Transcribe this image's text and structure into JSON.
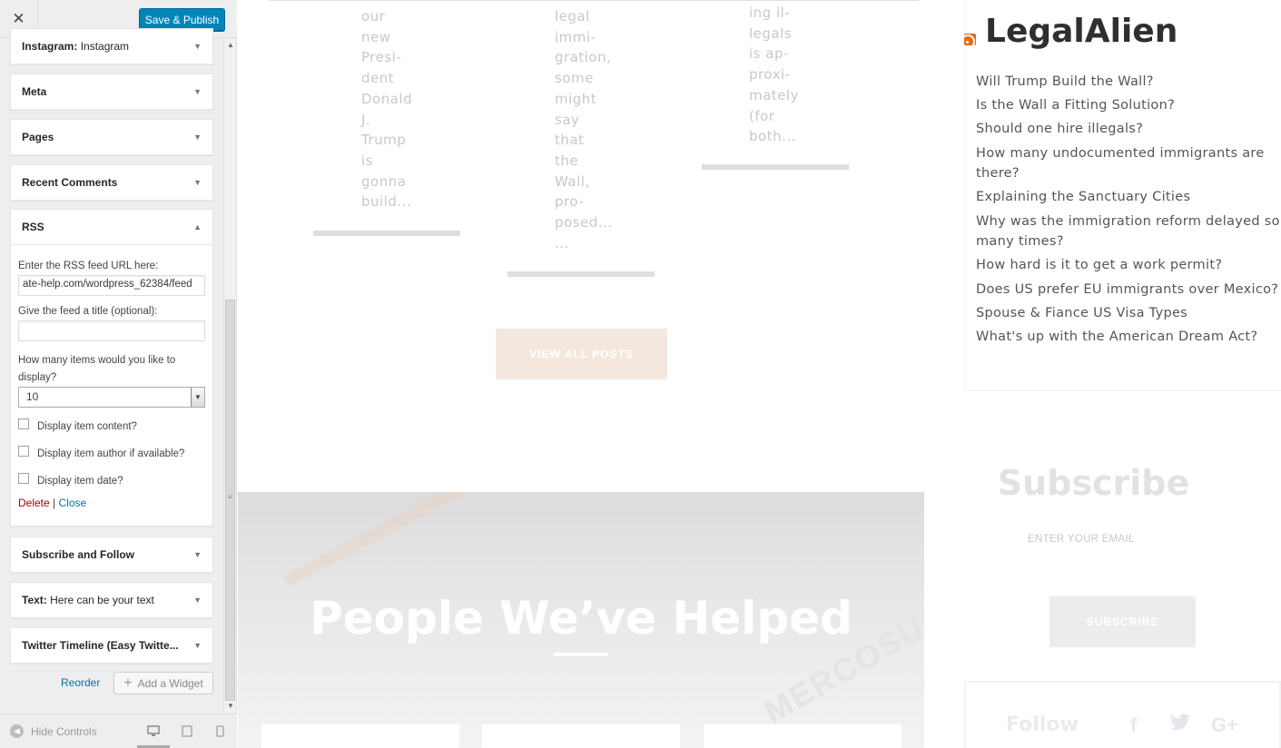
{
  "header": {
    "close_glyph": "✕",
    "publish_label": "Save & Publish"
  },
  "widgets": {
    "instagram": {
      "bold": "Instagram:",
      "rest": " Instagram"
    },
    "meta": {
      "bold": "Meta"
    },
    "pages": {
      "bold": "Pages"
    },
    "recent_comments": {
      "bold": "Recent Comments"
    },
    "rss": {
      "bold": "RSS"
    },
    "subscribe_follow": {
      "bold": "Subscribe and Follow"
    },
    "text": {
      "bold": "Text:",
      "rest": " Here can be your text"
    },
    "twitter": {
      "bold": "Twitter Timeline (Easy Twitte..."
    }
  },
  "rss_form": {
    "url_label": "Enter the RSS feed URL here:",
    "url_value": "ate-help.com/wordpress_62384/feed",
    "title_label": "Give the feed a title (optional):",
    "title_value": "",
    "items_label": "How many items would you like to display?",
    "items_value": "10",
    "opt_content": "Display item content?",
    "opt_author": "Display item author if available?",
    "opt_date": "Display item date?",
    "delete_label": "Delete",
    "separator": " | ",
    "close_label": "Close"
  },
  "footer": {
    "reorder_label": "Reorder",
    "add_widget_label": "Add a Widget",
    "hide_controls_label": "Hide Controls"
  },
  "preview": {
    "columns": [
      {
        "lines": [
          "our",
          "new",
          "Presi-",
          "dent",
          "Donald",
          "J.",
          "Trump",
          "is",
          "gonna",
          "build..."
        ]
      },
      {
        "lines": [
          "legal",
          "immi-",
          "gration,",
          "some",
          "might",
          "say",
          "that",
          "the",
          "Wall,",
          "pro-",
          "posed...",
          "..."
        ]
      },
      {
        "lines": [
          "ing il-",
          "legals",
          "is ap-",
          "proxi-",
          "mately",
          "(for",
          "both..."
        ]
      }
    ],
    "view_all_label": "VIEW ALL POSTS",
    "hero_title": "People We’ve Helped",
    "hero_watermark": "MERCOSUL FEDE",
    "rss_widget_title": "LegalAlien",
    "rss_items": [
      "Will Trump Build the Wall?",
      "Is the Wall a Fitting Solution?",
      "Should one hire illegals?",
      "How many undocumented immigrants are there?",
      "Explaining the Sanctuary Cities",
      "Why was the immigration reform delayed so many times?",
      "How hard is it to get a work permit?",
      "Does US prefer EU immigrants over Mexico?",
      "Spouse & Fiance US Visa Types",
      "What's up with the American Dream Act?"
    ],
    "subscribe_title": "Subscribe",
    "email_placeholder": "ENTER YOUR EMAIL",
    "subscribe_button": "SUBSCRIBE",
    "follow_title": "Follow",
    "social": {
      "facebook": "f",
      "twitter": "🐦",
      "gplus": "G+"
    }
  },
  "colors": {
    "publish": "#0085ba",
    "link": "#0073aa",
    "delete": "#a00000",
    "rss_orange": "#e46a14"
  }
}
